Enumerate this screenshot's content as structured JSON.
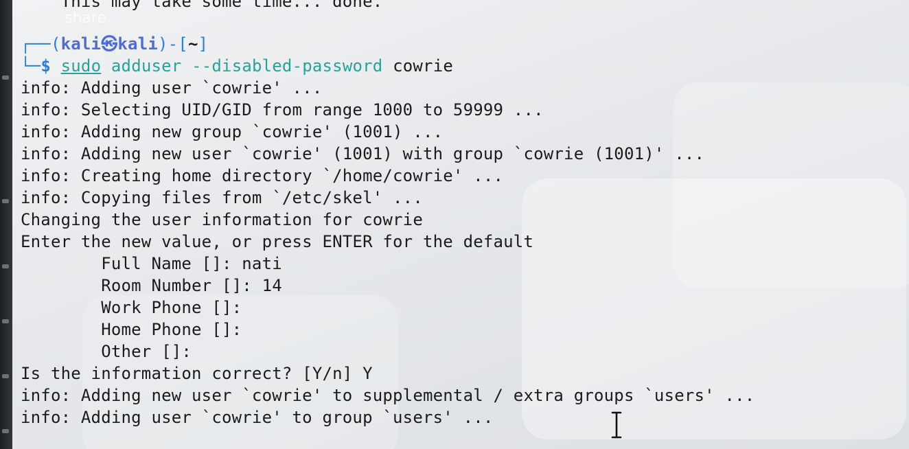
{
  "terminal": {
    "top_partial": "    This may take some time... done.",
    "overlay_text": "share",
    "prompt": {
      "box_top": "┌──(",
      "user": "kali㉿kali",
      "bracket_mid": ")-[",
      "path": "~",
      "bracket_end": "]",
      "box_bottom": "└─",
      "dollar": "$",
      "cmd_sudo": "sudo",
      "cmd_main": "adduser",
      "cmd_flag": "--disabled-password",
      "cmd_arg": "cowrie"
    },
    "output_lines": [
      "info: Adding user `cowrie' ...",
      "info: Selecting UID/GID from range 1000 to 59999 ...",
      "info: Adding new group `cowrie' (1001) ...",
      "info: Adding new user `cowrie' (1001) with group `cowrie (1001)' ...",
      "info: Creating home directory `/home/cowrie' ...",
      "info: Copying files from `/etc/skel' ...",
      "Changing the user information for cowrie",
      "Enter the new value, or press ENTER for the default",
      "        Full Name []: nati",
      "        Room Number []: 14",
      "        Work Phone []:",
      "        Home Phone []:",
      "        Other []:",
      "Is the information correct? [Y/n] Y",
      "info: Adding new user `cowrie' to supplemental / extra groups `users' ...",
      "info: Adding user `cowrie' to group `users' ..."
    ]
  },
  "colors": {
    "prompt_frame": "#2a7fd8",
    "prompt_user": "#4f6bd6",
    "command": "#2aa198",
    "text": "#1b1b1b"
  },
  "icons": {
    "cursor": "text-cursor-icon"
  }
}
